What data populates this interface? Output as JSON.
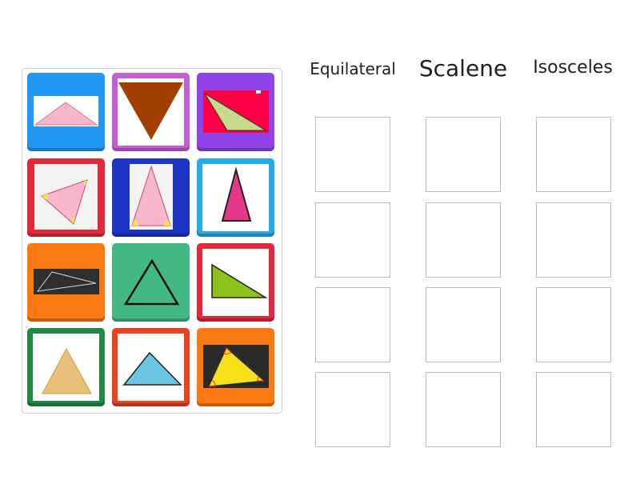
{
  "headings": {
    "equilateral": "Equilateral",
    "scalene": "Scalene",
    "isosceles": "Isosceles"
  },
  "tiles": [
    {
      "icon": "pink-obtuse-triangle-icon",
      "frame_color": "#2196f3"
    },
    {
      "icon": "brown-inverted-triangle-icon",
      "frame_color": "#c35fd6"
    },
    {
      "icon": "green-obtuse-triangle-on-red-icon",
      "frame_color": "#8e44e8"
    },
    {
      "icon": "pink-marked-triangle-icon",
      "frame_color": "#e02a3c"
    },
    {
      "icon": "pink-tall-isosceles-triangle-icon",
      "frame_color": "#1e35c4"
    },
    {
      "icon": "magenta-isosceles-triangle-icon",
      "frame_color": "#29a8ea"
    },
    {
      "icon": "chalkboard-scalene-triangle-icon",
      "frame_color": "#fd7a12"
    },
    {
      "icon": "green-equilateral-triangle-icon",
      "frame_color": "#42b883"
    },
    {
      "icon": "lime-right-triangle-icon",
      "frame_color": "#e02a3c"
    },
    {
      "icon": "tan-equilateral-triangle-icon",
      "frame_color": "#1f8a45"
    },
    {
      "icon": "blue-scalene-triangle-icon",
      "frame_color": "#e8431e"
    },
    {
      "icon": "yellow-marked-triangle-on-chalkboard-icon",
      "frame_color": "#fd7a12"
    }
  ],
  "drop_zones": {
    "columns": [
      "equilateral",
      "scalene",
      "isosceles"
    ],
    "rows_per_column": 4
  }
}
